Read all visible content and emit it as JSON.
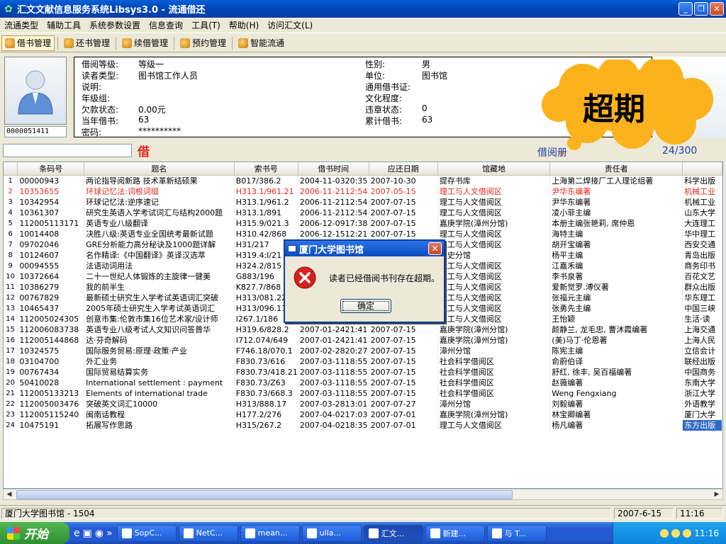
{
  "window": {
    "title": "汇文文献信息服务系统Libsys3.0 - 流通借还"
  },
  "menu": [
    "流通类型",
    "辅助工具",
    "系统参数设置",
    "信息查询",
    "工具(T)",
    "帮助(H)",
    "访问汇文(L)"
  ],
  "toolbar": [
    "借书管理",
    "还书管理",
    "续借管理",
    "预约管理",
    "智能流通"
  ],
  "reader": {
    "id": "0000051411",
    "borrow_level_label": "借阅等级:",
    "borrow_level": "等级一",
    "type_label": "读者类型:",
    "type": "图书馆工作人员",
    "note_label": "说明:",
    "note": "",
    "grade_label": "年级组:",
    "grade": "",
    "debt_label": "欠款状态:",
    "debt": "0.00元",
    "current_label": "当年借书:",
    "current": "63",
    "password_label": "密码:",
    "password": "**********",
    "gender_label": "性别:",
    "gender": "男",
    "unit_label": "单位:",
    "unit": "图书馆",
    "card_label": "通用借书证:",
    "card": "",
    "edu_label": "文化程度:",
    "edu": "",
    "violation_label": "违章状态:",
    "violation": "0",
    "total_label": "累计借书:",
    "total": "63"
  },
  "overlay": {
    "bubble_text": "超期"
  },
  "borrow": {
    "label": "借",
    "stats": "借阅册",
    "count": "24/300"
  },
  "table": {
    "columns": [
      "条码号",
      "题名",
      "索书号",
      "借书时间",
      "应还日期",
      "馆藏地",
      "责任者",
      ""
    ],
    "rows": [
      [
        "1",
        "00000943",
        "两论指导阅新路 技术革新结硕果",
        "B017/386.2",
        "2004-11-0320:35",
        "2007-10-30",
        "提存书库",
        "上海第二焊接厂工人理论组著",
        "科学出版"
      ],
      [
        "2",
        "10353655",
        "环球记忆法:词根词缀",
        "H313.1/961.21",
        "2006-11-2112:54",
        "2007-05-15",
        "理工与人文借阅区",
        "尹华东编著",
        "机械工业"
      ],
      [
        "3",
        "10342954",
        "环球记忆法:逆序速记",
        "H313.1/961.2",
        "2006-11-2112:54",
        "2007-07-15",
        "理工与人文借阅区",
        "尹华东编著",
        "机械工业"
      ],
      [
        "4",
        "10361307",
        "研究生英语入学考试词汇与结构2000题",
        "H313.1/891",
        "2006-11-2112:54",
        "2007-07-15",
        "理工与人文借阅区",
        "凌小菲主编",
        "山东大学"
      ],
      [
        "5",
        "112005113171",
        "英语专业八级翻译",
        "H315.9/021.3",
        "2006-12-0917:38",
        "2007-07-15",
        "嘉庚学院(漳州分馆)",
        "本册主编张艳莉, 席仲恩",
        "大连理工"
      ],
      [
        "6",
        "10014408",
        "决胜八级:英语专业全国统考最新试题",
        "H310.42/868",
        "2006-12-1512:21",
        "2007-07-15",
        "理工与人文借阅区",
        "海特主编",
        "华中理工"
      ],
      [
        "7",
        "09702046",
        "GRE分析能力高分秘诀及1000题详解",
        "H31/217",
        "",
        "2007-07-15",
        "理工与人文借阅区",
        "胡开宝编著",
        "西安交通"
      ],
      [
        "8",
        "10124607",
        "名作精译:《中国翻译》英译汉选萃",
        "H319.4:I/21",
        "",
        "2007-07-15",
        "文史分馆",
        "杨平主编",
        "青岛出版"
      ],
      [
        "9",
        "00094555",
        "法语动词用法",
        "H324.2/815",
        "",
        "2007-07-15",
        "理工与人文借阅区",
        "江嘉禾编",
        "商务印书"
      ],
      [
        "10",
        "10372664",
        "二十一世纪人体锻炼的主旋律一健美",
        "G883/196",
        "",
        "2007-07-15",
        "理工与人文借阅区",
        "李书泉著",
        "百花文艺"
      ],
      [
        "11",
        "10386279",
        "我的前半生",
        "K827.7/868",
        "",
        "2007-07-15",
        "理工与人文借阅区",
        "爱新觉罗.溥仪著",
        "群众出版"
      ],
      [
        "12",
        "00767829",
        "最新硕士研究生入学考试英语词汇突破",
        "H313/081.22",
        "",
        "2007-07-15",
        "理工与人文借阅区",
        "张福元主编",
        "华东理工"
      ],
      [
        "13",
        "10465437",
        "2005年硕士研究生入学考试英语词汇",
        "H313/096.11",
        "",
        "2007-07-15",
        "理工与人文借阅区",
        "张勇先主编",
        "中国三峡"
      ],
      [
        "14",
        "112005024305",
        "创意市集:伦敦市集16位艺术家/设计师",
        "I267.1/186",
        "",
        "2007-07-15",
        "理工与人文借阅区",
        "王怡颖",
        "生活·读"
      ],
      [
        "15",
        "112006083738",
        "英语专业八级考试人文知识问答普华",
        "H319.6/828.2",
        "2007-01-2421:41",
        "2007-07-15",
        "嘉庚学院(漳州分馆)",
        "颜静兰, 龙毛忠, 曹沐霞编著",
        "上海交通"
      ],
      [
        "16",
        "112005144868",
        "达·芬奇解码",
        "I712.074/649",
        "2007-01-2421:41",
        "2007-07-15",
        "嘉庚学院(漳州分馆)",
        "(美)马丁·伦恩著",
        "上海人民"
      ],
      [
        "17",
        "10324575",
        "国际服务贸易:原理·政策·产业",
        "F746.18/070.1",
        "2007-02-2820:27",
        "2007-07-15",
        "漳州分馆",
        "陈宪主编",
        "立信会计"
      ],
      [
        "18",
        "03104700",
        "外汇业务",
        "F830.73/616",
        "2007-03-1118:55",
        "2007-07-15",
        "社会科学借阅区",
        "俞蔚伯译",
        "联经出版"
      ],
      [
        "19",
        "00767434",
        "国际贸易结算实务",
        "F830.73/418.21",
        "2007-03-1118:55",
        "2007-07-15",
        "社会科学借阅区",
        "舒红, 徐丰, 吴百福编著",
        "中国商务"
      ],
      [
        "20",
        "50410028",
        "International settlement : payment",
        "F830.73/Z63",
        "2007-03-1118:55",
        "2007-07-15",
        "社会科学借阅区",
        "赵薇编著",
        "东南大学"
      ],
      [
        "21",
        "112005133213",
        "Elements of international trade",
        "F830.73/668.3",
        "2007-03-1118:55",
        "2007-07-15",
        "社会科学借阅区",
        "Weng Fengxiang",
        "浙江大学"
      ],
      [
        "22",
        "112005003476",
        "突破英文词汇10000",
        "H313/888.17",
        "2007-03-2813:01",
        "2007-07-27",
        "漳州分馆",
        "刘毅编著",
        "外语教学"
      ],
      [
        "23",
        "112005115240",
        "闽南话教程",
        "H177.2/276",
        "2007-04-0217:03",
        "2007-07-01",
        "嘉庚学院(漳州分馆)",
        "林宝卿编著",
        "厦门大学"
      ],
      [
        "24",
        "10475191",
        "拓展写作思路",
        "H315/267.2",
        "2007-04-0218:35",
        "2007-07-01",
        "理工与人文借阅区",
        "杨凡编著",
        "东方出版"
      ]
    ],
    "overdue_row": 1,
    "selected_cell": [
      23,
      8
    ]
  },
  "statusbar": {
    "left": "厦门大学图书馆 - 1504",
    "date": "2007-6-15",
    "time": "11:16"
  },
  "dialog": {
    "title": "厦门大学图书馆",
    "message": "读者已经借阅书刊存在超期。",
    "ok": "确定"
  },
  "taskbar": {
    "start": "开始",
    "tasks": [
      "SopC...",
      "NetC...",
      "mean...",
      "ulla...",
      "汇文...",
      "新建...",
      "与 T..."
    ],
    "active_task": 4,
    "clock": "11:16"
  }
}
